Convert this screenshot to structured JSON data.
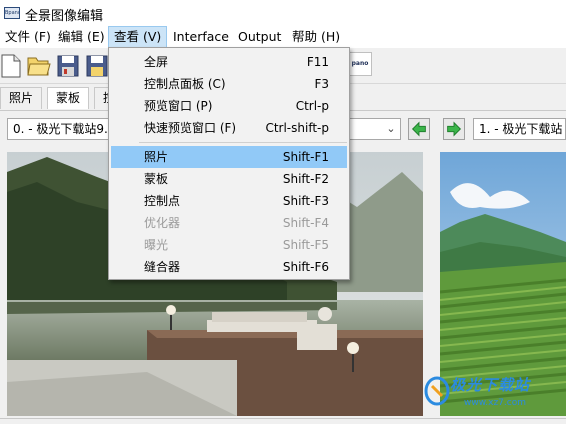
{
  "app": {
    "title": "全景图像编辑",
    "icon": "panorama-app-icon",
    "icon_text": "Bpano"
  },
  "menubar": {
    "items": [
      {
        "label": "文件 (F)"
      },
      {
        "label": "编辑 (E)"
      },
      {
        "label": "查看 (V)"
      },
      {
        "label": "Interface"
      },
      {
        "label": "Output"
      },
      {
        "label": "帮助 (H)"
      }
    ],
    "active_index": 2
  },
  "toolbar": {
    "buttons": [
      "new-file-icon",
      "open-folder-icon",
      "save-icon",
      "save-as-icon"
    ],
    "logo_text": "pano"
  },
  "tabs": [
    {
      "label": "照片"
    },
    {
      "label": "蒙板"
    },
    {
      "label": "控"
    }
  ],
  "image_selector": {
    "left_value": "0. - 极光下载站9.",
    "right_value": "1. - 极光下载站",
    "prev_icon": "arrow-left-icon",
    "next_icon": "arrow-right-icon"
  },
  "view_menu": {
    "items": [
      {
        "label": "全屏",
        "shortcut": "F11",
        "enabled": true
      },
      {
        "label": "控制点面板 (C)",
        "shortcut": "F3",
        "enabled": true
      },
      {
        "label": "预览窗口 (P)",
        "shortcut": "Ctrl-p",
        "enabled": true
      },
      {
        "label": "快速预览窗口 (F)",
        "shortcut": "Ctrl-shift-p",
        "enabled": true
      },
      {
        "label": "照片",
        "shortcut": "Shift-F1",
        "enabled": true,
        "highlighted": true
      },
      {
        "label": "蒙板",
        "shortcut": "Shift-F2",
        "enabled": true
      },
      {
        "label": "控制点",
        "shortcut": "Shift-F3",
        "enabled": true
      },
      {
        "label": "优化器",
        "shortcut": "Shift-F4",
        "enabled": false
      },
      {
        "label": "曝光",
        "shortcut": "Shift-F5",
        "enabled": false
      },
      {
        "label": "缝合器",
        "shortcut": "Shift-F6",
        "enabled": true
      }
    ]
  },
  "watermark": {
    "text": "极光下载站",
    "url": "www.xz7.com"
  },
  "colors": {
    "menu_highlight": "#91c9f7",
    "menu_active": "#cce4f7",
    "watermark": "#2b8be0"
  }
}
